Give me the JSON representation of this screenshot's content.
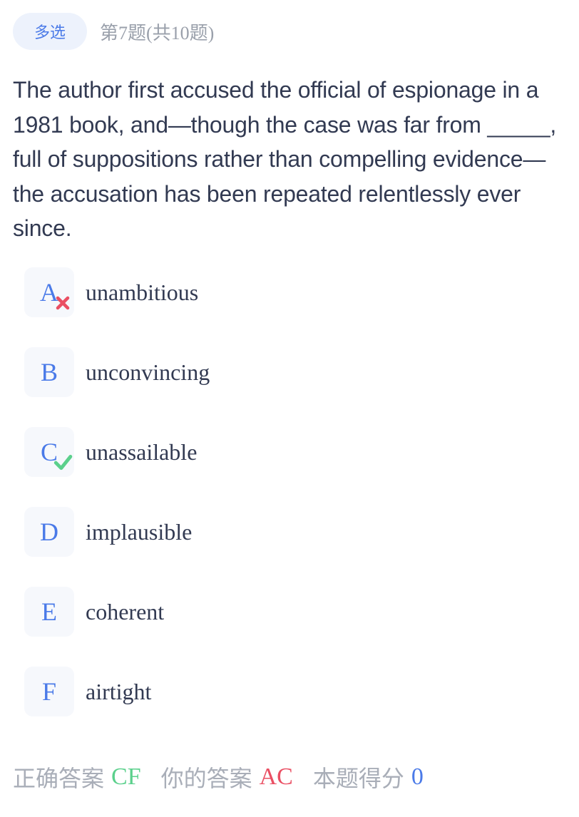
{
  "header": {
    "type_label": "多选",
    "progress": "第7题(共10题)"
  },
  "question": {
    "text": "The author first accused the official of espionage in a 1981 book, and—though the case was far from _____, full of suppositions rather than compelling evidence—the accusation has been repeated relentlessly ever since."
  },
  "options": [
    {
      "letter": "A",
      "text": "unambitious",
      "mark": "wrong-icon"
    },
    {
      "letter": "B",
      "text": "unconvincing",
      "mark": ""
    },
    {
      "letter": "C",
      "text": "unassailable",
      "mark": "check-icon"
    },
    {
      "letter": "D",
      "text": "implausible",
      "mark": ""
    },
    {
      "letter": "E",
      "text": "coherent",
      "mark": ""
    },
    {
      "letter": "F",
      "text": "airtight",
      "mark": ""
    }
  ],
  "footer": {
    "correct_label": "正确答案",
    "correct_value": "CF",
    "user_label": "你的答案",
    "user_value": "AC",
    "score_label": "本题得分",
    "score_value": "0"
  },
  "colors": {
    "accent": "#4a7ae8",
    "correct": "#5bd08c",
    "wrong": "#ea4f63",
    "muted": "#a9aeb8"
  }
}
